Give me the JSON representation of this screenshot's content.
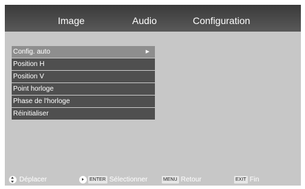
{
  "tabs": [
    {
      "label": "Image"
    },
    {
      "label": "Audio"
    },
    {
      "label": "Configuration"
    }
  ],
  "menu": {
    "items": [
      {
        "label": "Config. auto",
        "selected": true,
        "has_submenu": true
      },
      {
        "label": "Position H"
      },
      {
        "label": "Position V"
      },
      {
        "label": "Point horloge"
      },
      {
        "label": "Phase de l'horloge"
      },
      {
        "label": "Réinitialiser"
      }
    ],
    "submenu_arrow": "▶"
  },
  "footer": {
    "move_label": "Déplacer",
    "enter_key": "ENTER",
    "select_label": "Sélectionner",
    "menu_key": "MENU",
    "back_label": "Retour",
    "exit_key": "EXIT",
    "end_label": "Fin"
  },
  "colors": {
    "background": "#c7c7c7",
    "tabbar": "#3a3a3a",
    "menu_item": "#4f4f4f",
    "menu_item_selected": "#8e8e8e",
    "text": "#ffffff"
  }
}
